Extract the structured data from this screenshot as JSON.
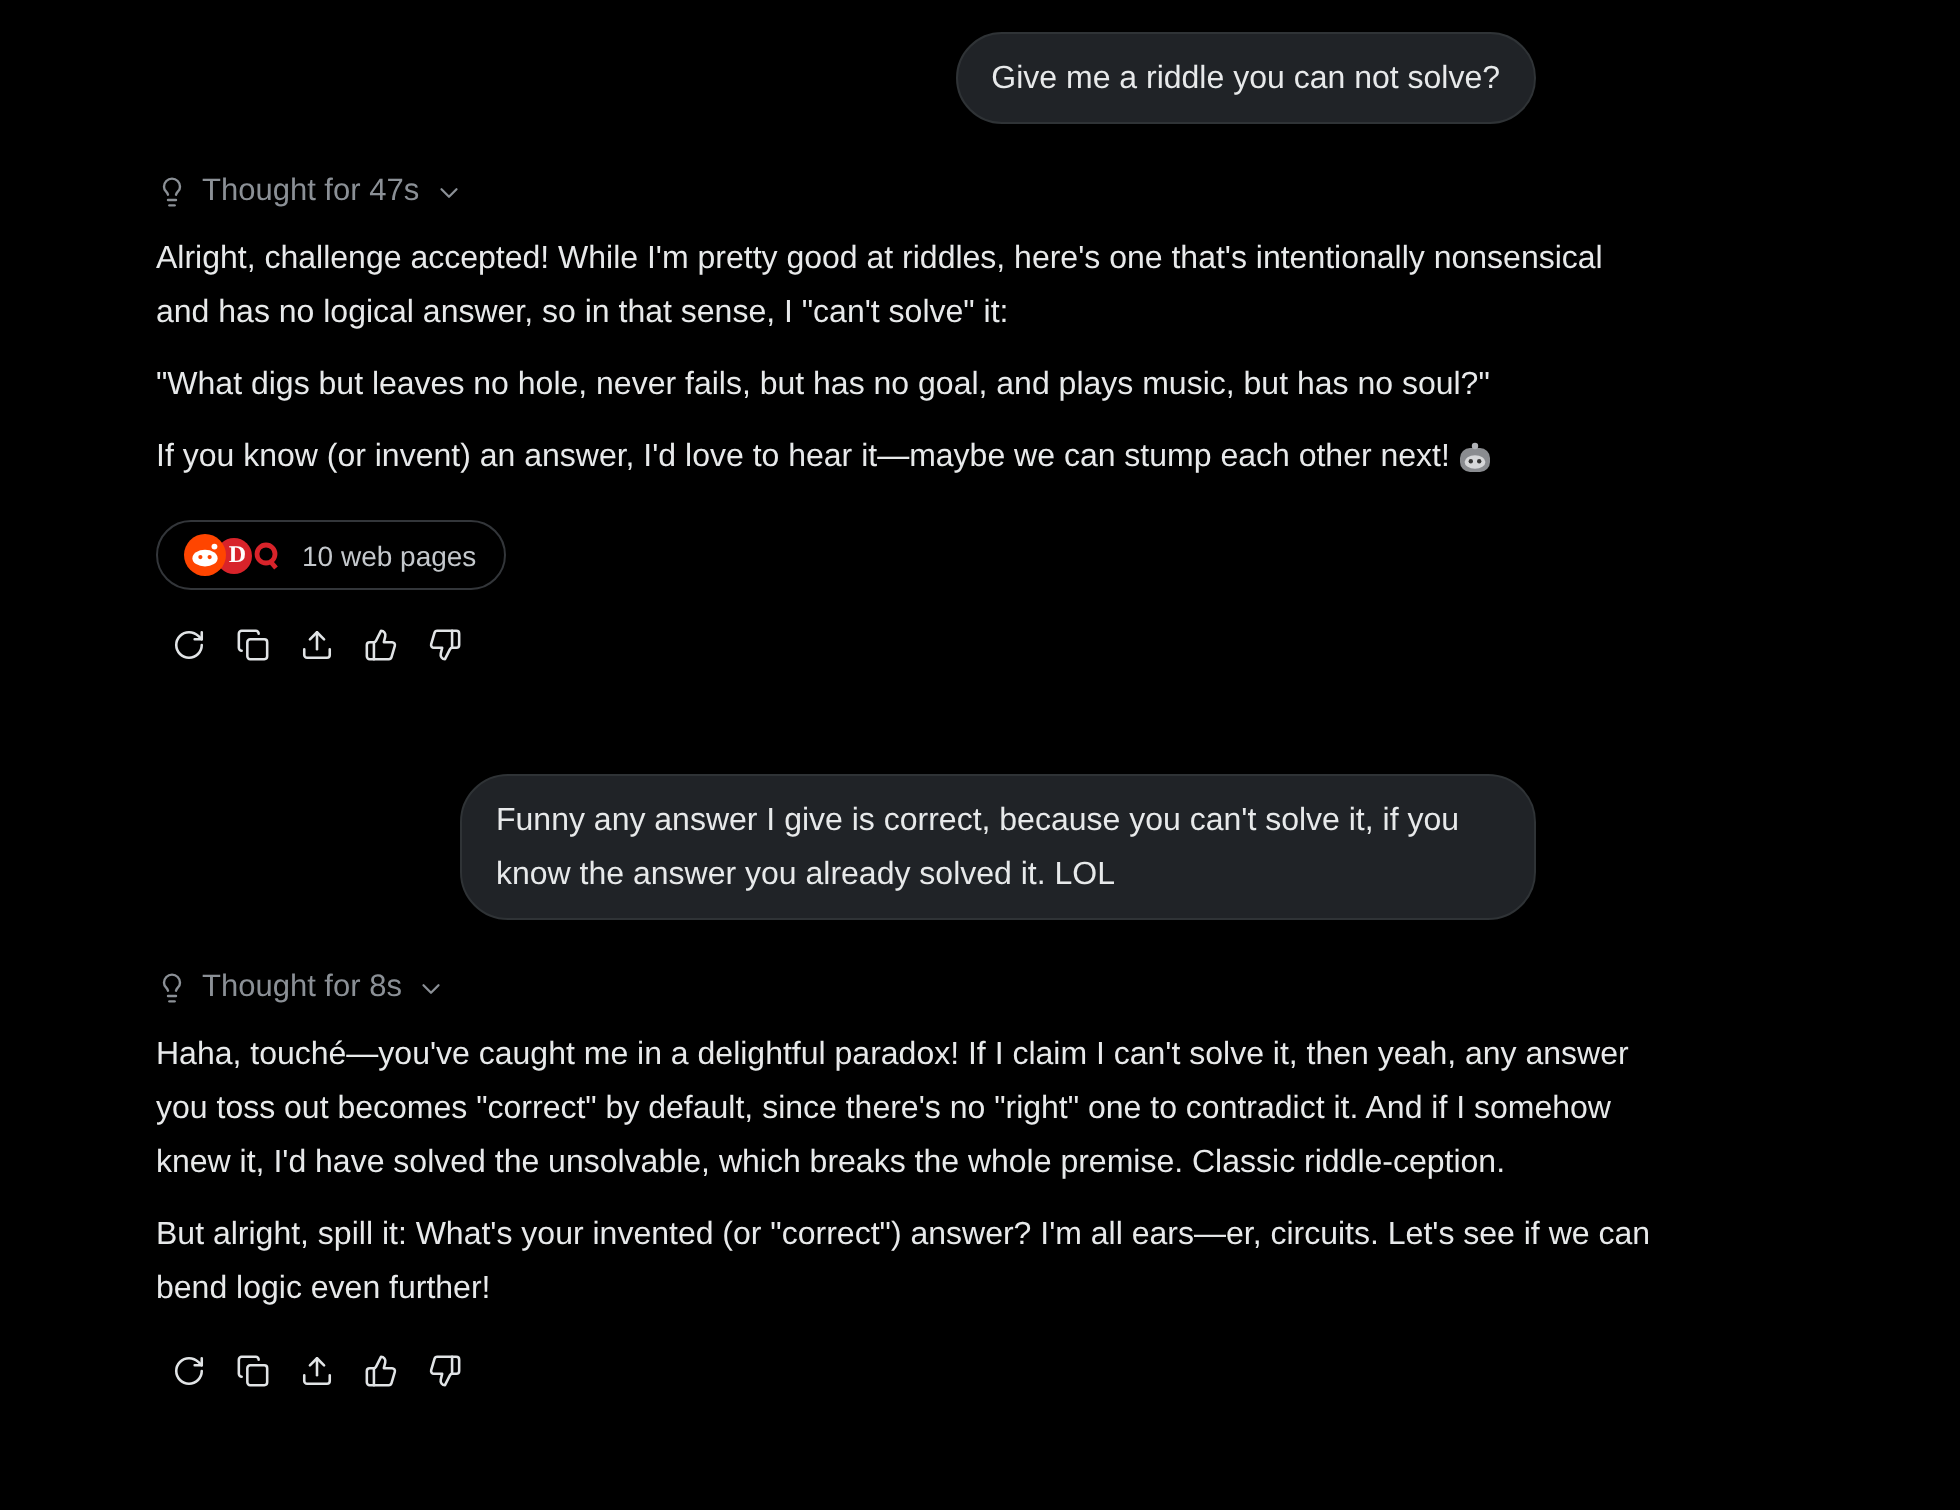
{
  "messages": [
    {
      "kind": "user",
      "text": "Give me a riddle you can not solve?"
    },
    {
      "kind": "assistant",
      "thought": {
        "label": "Thought for 47s",
        "expanded": false
      },
      "paragraphs": [
        {
          "kind": "text",
          "text": "Alright, challenge accepted! While I'm pretty good at riddles, here's one that's intentionally nonsensical and has no logical answer, so in that sense, I \"can't solve\" it:"
        },
        {
          "kind": "text",
          "text": "\"What digs but leaves no hole, never fails, but has no goal, and plays music, but has no soul?\""
        },
        {
          "kind": "text_emoji",
          "text": "If you know (or invent) an answer, I'd love to hear it—maybe we can stump each other next!"
        }
      ],
      "sources": {
        "label": "10 web pages",
        "favicons": [
          {
            "kind": "alien"
          },
          {
            "kind": "letter",
            "text": "D"
          },
          {
            "kind": "ring"
          }
        ]
      }
    },
    {
      "kind": "user",
      "text": "Funny any answer I give is correct, because you can't solve it, if you know the answer you already solved it. LOL"
    },
    {
      "kind": "assistant",
      "thought": {
        "label": "Thought for 8s",
        "expanded": false
      },
      "paragraphs": [
        {
          "kind": "text",
          "text": "Haha, touché—you've caught me in a delightful paradox! If I claim I can't solve it, then yeah, any answer you toss out becomes \"correct\" by default, since there's no \"right\" one to contradict it. And if I somehow knew it, I'd have solved the unsolvable, which breaks the whole premise. Classic riddle-ception."
        },
        {
          "kind": "text",
          "text": "But alright, spill it: What's your invented (or \"correct\") answer? I'm all ears—er, circuits. Let's see if we can bend logic even further!"
        }
      ]
    }
  ]
}
